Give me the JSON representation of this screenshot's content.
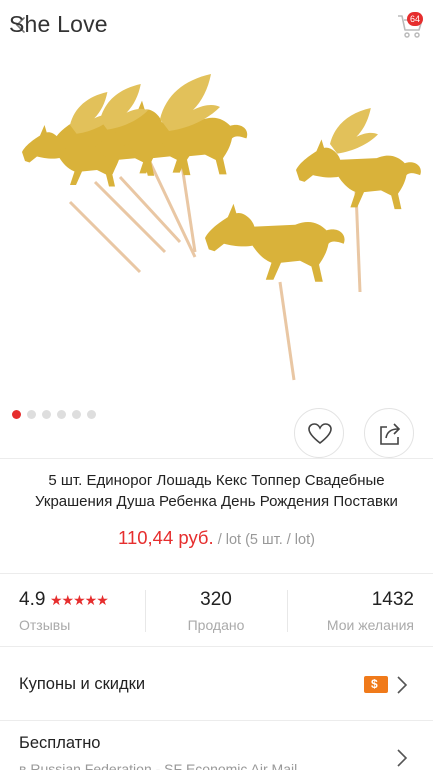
{
  "header": {
    "store_name": "She Love",
    "cart_count": "64"
  },
  "gallery": {
    "image_count": 6,
    "active_index": 0
  },
  "product": {
    "title": "5 шт. Единорог Лошадь Кекс Топпер Свадебные Украшения Душа Ребенка День Рождения Поставки",
    "price": "110,44 руб.",
    "price_unit": "/ lot (5 шт. / lot)"
  },
  "stats": {
    "rating": "4.9",
    "stars": "★★★★★",
    "reviews_label": "Отзывы",
    "sold": "320",
    "sold_label": "Продано",
    "wishes": "1432",
    "wishes_label": "Мои желания"
  },
  "coupons": {
    "label": "Купоны и скидки",
    "icon": "coupon-icon"
  },
  "shipping": {
    "label": "Бесплатно",
    "detail": "в Russian Federation - SF Economic Air Mail"
  },
  "colors": {
    "accent": "#e62e2e",
    "gold": "#d9b23a",
    "coupon": "#f07a1a"
  }
}
